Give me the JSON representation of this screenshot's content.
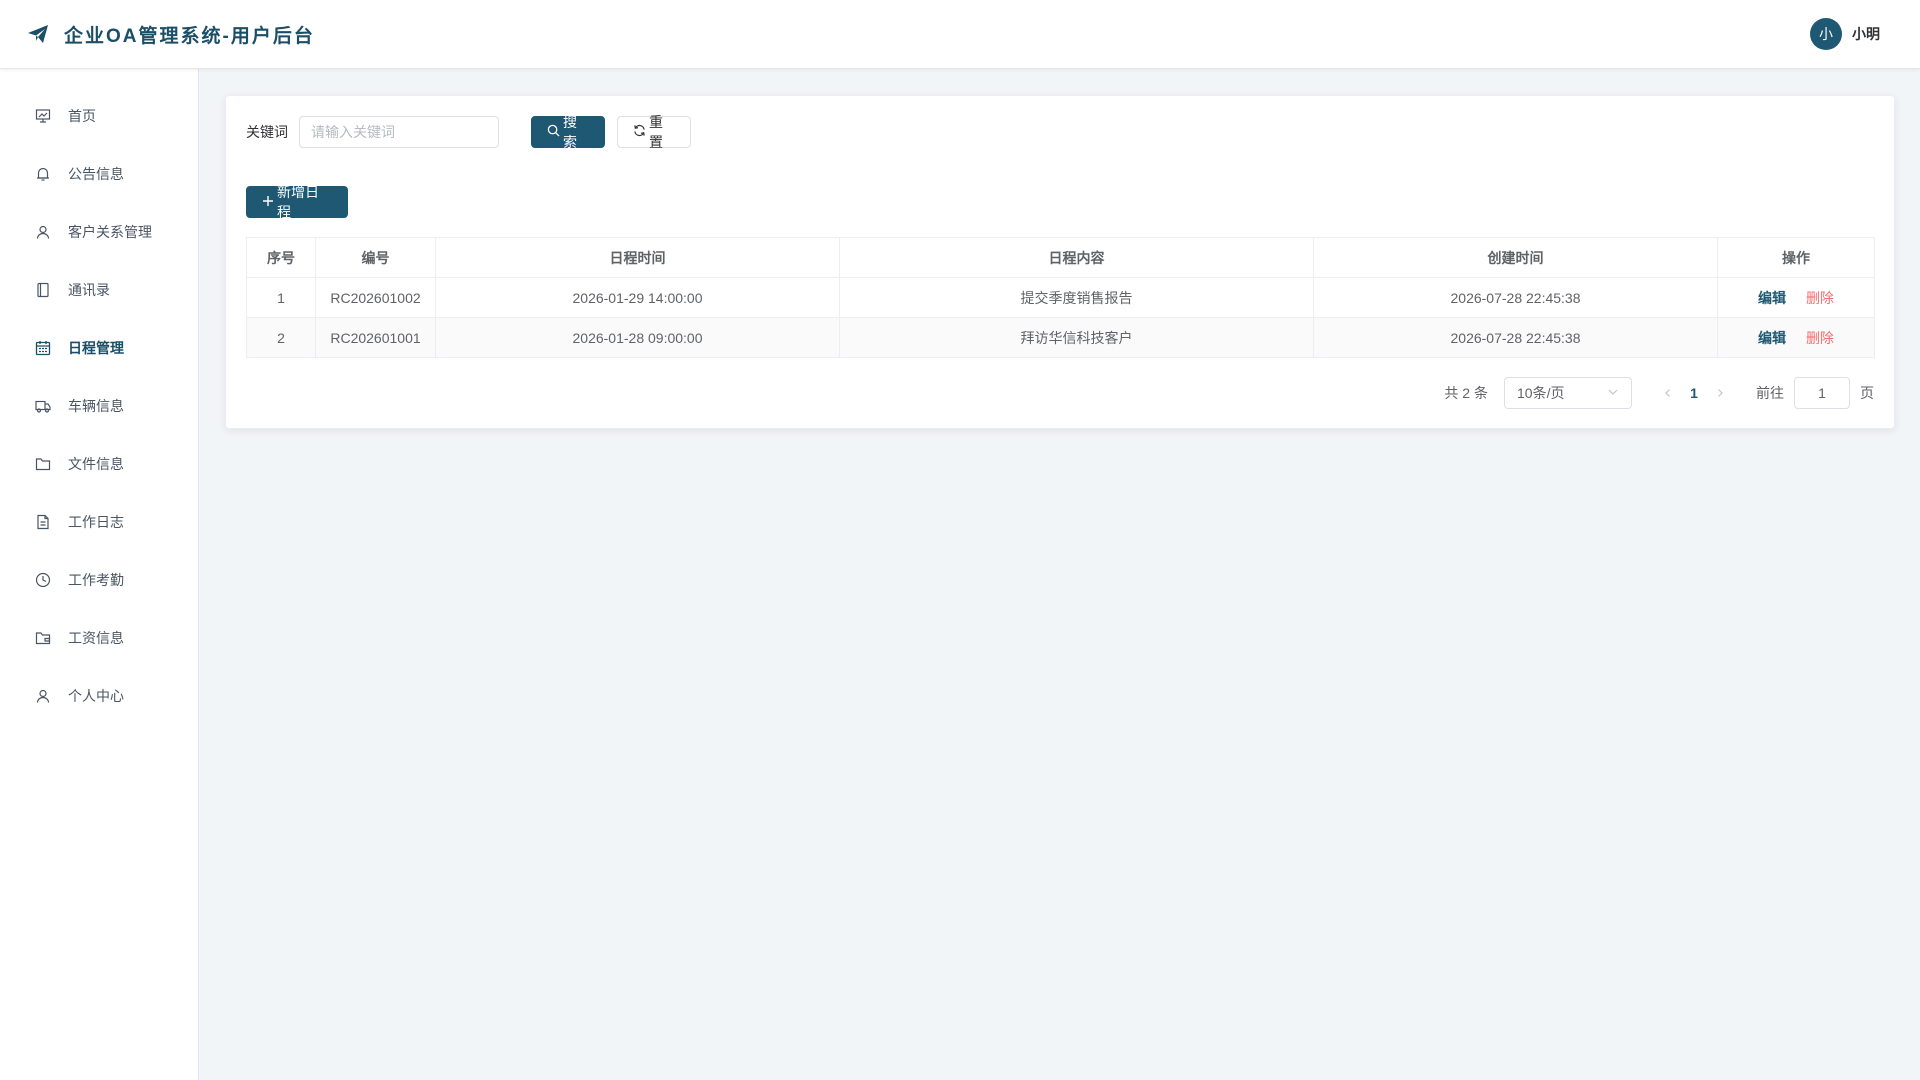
{
  "app": {
    "title": "企业OA管理系统-用户后台",
    "user_avatar": "小",
    "user_name": "小明",
    "accent_color": "#1e5873"
  },
  "sidebar": {
    "items": [
      {
        "label": "首页",
        "icon": "presentation-icon"
      },
      {
        "label": "公告信息",
        "icon": "bell-icon"
      },
      {
        "label": "客户关系管理",
        "icon": "user-icon"
      },
      {
        "label": "通讯录",
        "icon": "notebook-icon"
      },
      {
        "label": "日程管理",
        "icon": "calendar-icon",
        "active": true
      },
      {
        "label": "车辆信息",
        "icon": "truck-icon"
      },
      {
        "label": "文件信息",
        "icon": "folder-icon"
      },
      {
        "label": "工作日志",
        "icon": "document-icon"
      },
      {
        "label": "工作考勤",
        "icon": "clock-icon"
      },
      {
        "label": "工资信息",
        "icon": "wallet-folder-icon"
      },
      {
        "label": "个人中心",
        "icon": "user-icon"
      }
    ]
  },
  "search": {
    "label": "关键词",
    "placeholder": "请输入关键词",
    "value": "",
    "search_button": "搜索",
    "reset_button": "重置"
  },
  "toolbar": {
    "add_button": "新增日程"
  },
  "table": {
    "columns": [
      "序号",
      "编号",
      "日程时间",
      "日程内容",
      "创建时间",
      "操作"
    ],
    "rows": [
      {
        "index": "1",
        "code": "RC202601002",
        "schedule_time": "2026-01-29 14:00:00",
        "content": "提交季度销售报告",
        "created": "2026-07-28 22:45:38",
        "edit": "编辑",
        "delete": "删除"
      },
      {
        "index": "2",
        "code": "RC202601001",
        "schedule_time": "2026-01-28 09:00:00",
        "content": "拜访华信科技客户",
        "created": "2026-07-28 22:45:38",
        "edit": "编辑",
        "delete": "删除"
      }
    ]
  },
  "pagination": {
    "total_text": "共 2 条",
    "page_size": "10条/页",
    "current_page": "1",
    "goto_label": "前往",
    "goto_value": "1",
    "unit": "页"
  }
}
